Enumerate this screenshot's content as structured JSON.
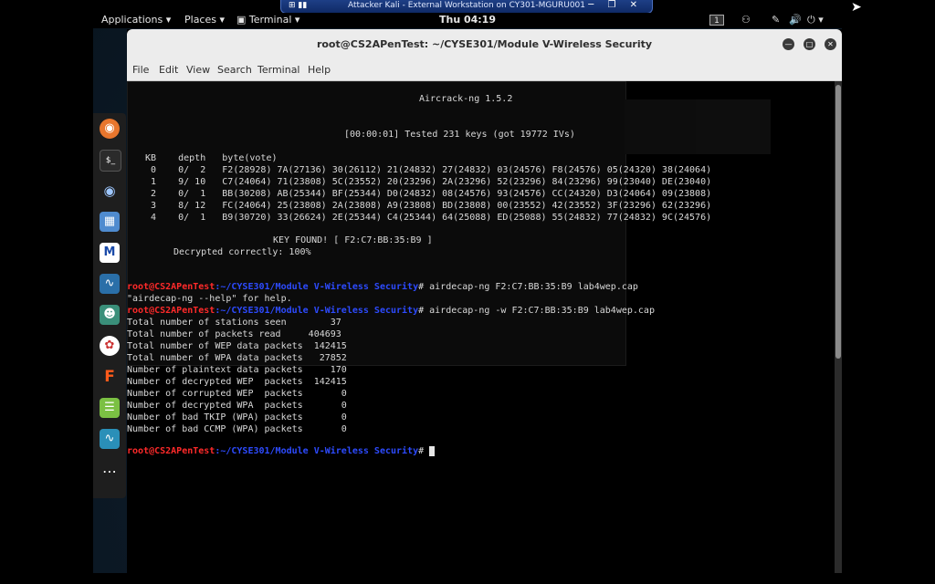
{
  "vm_bar": {
    "title": "Attacker Kali - External Workstation on CY301-MGURU001",
    "controls": "─ ❐ ✕"
  },
  "top_panel": {
    "applications": "Applications ▾",
    "places": "Places ▾",
    "terminal": "▣ Terminal ▾",
    "clock": "Thu 04:19",
    "workspace": "1"
  },
  "dock": [
    "firefox-icon",
    "terminal-icon",
    "eye-icon",
    "files-icon",
    "metasploit-icon",
    "wireshark-icon",
    "avatar-icon",
    "palette-icon",
    "flashy-icon",
    "notes-icon",
    "wireshark2-icon",
    "app-grid-icon"
  ],
  "window": {
    "title": "root@CS2APenTest: ~/CYSE301/Module V-Wireless Security",
    "menu": [
      "File",
      "Edit",
      "View",
      "Search",
      "Terminal",
      "Help"
    ]
  },
  "terminal": {
    "header": "Aircrack-ng 1.5.2",
    "status": "[00:00:01] Tested 231 keys (got 19772 IVs)",
    "table_header": "KB    depth   byte(vote)",
    "rows": [
      " 0    0/  2   F2(28928) 7A(27136) 30(26112) 21(24832) 27(24832) 03(24576) F8(24576) 05(24320) 38(24064)",
      " 1    9/ 10   C7(24064) 71(23808) 5C(23552) 20(23296) 2A(23296) 52(23296) 84(23296) 99(23040) DE(23040)",
      " 2    0/  1   BB(30208) AB(25344) BF(25344) D0(24832) 08(24576) 93(24576) CC(24320) D3(24064) 09(23808)",
      " 3    8/ 12   FC(24064) 25(23808) 2A(23808) A9(23808) BD(23808) 00(23552) 42(23552) 3F(23296) 62(23296)",
      " 4    0/  1   B9(30720) 33(26624) 2E(25344) C4(25344) 64(25088) ED(25088) 55(24832) 77(24832) 9C(24576)"
    ],
    "key_found": "KEY FOUND! [ F2:C7:BB:35:B9 ]",
    "decrypted": "Decrypted correctly: 100%",
    "prompt_user": "root@CS2APenTest",
    "prompt_path": ":~/CYSE301/Module V-Wireless Security",
    "cmd1": "# airdecap-ng F2:C7:BB:35:B9 lab4wep.cap",
    "help_line": "\"airdecap-ng --help\" for help.",
    "cmd2": "# airdecap-ng -w F2:C7:BB:35:B9 lab4wep.cap",
    "stats": [
      "Total number of stations seen        37",
      "Total number of packets read     404693",
      "Total number of WEP data packets  142415",
      "Total number of WPA data packets   27852",
      "Number of plaintext data packets     170",
      "Number of decrypted WEP  packets  142415",
      "Number of corrupted WEP  packets       0",
      "Number of decrypted WPA  packets       0",
      "Number of bad TKIP (WPA) packets       0",
      "Number of bad CCMP (WPA) packets       0"
    ],
    "prompt_end": "#"
  }
}
